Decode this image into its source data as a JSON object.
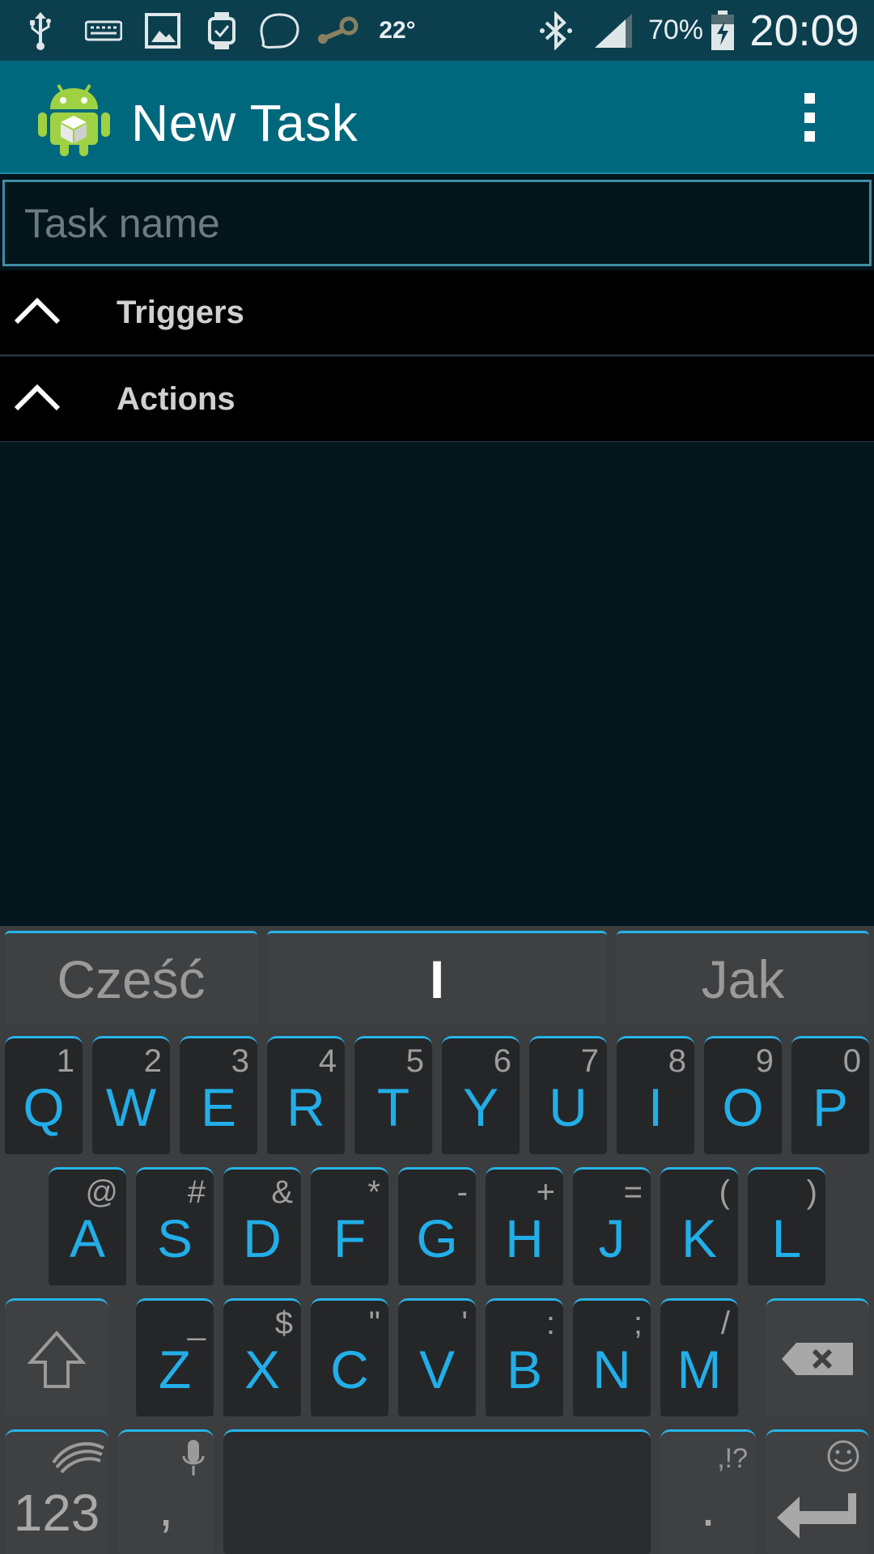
{
  "status_bar": {
    "temperature": "22°",
    "battery": "70%",
    "time": "20:09",
    "icons": [
      "usb-icon",
      "keyboard-icon",
      "image-icon",
      "smartwatch-icon",
      "speech-bubble-icon",
      "steam-icon",
      "bluetooth-icon",
      "signal-icon",
      "battery-charging-icon"
    ]
  },
  "app_bar": {
    "title": "New Task",
    "icon": "android-app-icon",
    "menu_icon": "overflow-menu-icon"
  },
  "task_name": {
    "placeholder": "Task name",
    "value": ""
  },
  "sections": [
    {
      "label": "Triggers",
      "icon": "chevron-up-icon"
    },
    {
      "label": "Actions",
      "icon": "chevron-up-icon"
    }
  ],
  "keyboard": {
    "suggestions": [
      "Cześć",
      "I",
      "Jak"
    ],
    "rows": [
      [
        {
          "main": "Q",
          "sub": "1"
        },
        {
          "main": "W",
          "sub": "2"
        },
        {
          "main": "E",
          "sub": "3"
        },
        {
          "main": "R",
          "sub": "4"
        },
        {
          "main": "T",
          "sub": "5"
        },
        {
          "main": "Y",
          "sub": "6"
        },
        {
          "main": "U",
          "sub": "7"
        },
        {
          "main": "I",
          "sub": "8"
        },
        {
          "main": "O",
          "sub": "9"
        },
        {
          "main": "P",
          "sub": "0"
        }
      ],
      [
        {
          "main": "A",
          "sub": "@"
        },
        {
          "main": "S",
          "sub": "#"
        },
        {
          "main": "D",
          "sub": "&"
        },
        {
          "main": "F",
          "sub": "*"
        },
        {
          "main": "G",
          "sub": "-"
        },
        {
          "main": "H",
          "sub": "+"
        },
        {
          "main": "J",
          "sub": "="
        },
        {
          "main": "K",
          "sub": "("
        },
        {
          "main": "L",
          "sub": ")"
        }
      ],
      [
        {
          "main": "Z",
          "sub": "_"
        },
        {
          "main": "X",
          "sub": "$"
        },
        {
          "main": "C",
          "sub": "\""
        },
        {
          "main": "V",
          "sub": "'"
        },
        {
          "main": "B",
          "sub": ":"
        },
        {
          "main": "N",
          "sub": ";"
        },
        {
          "main": "M",
          "sub": "/"
        }
      ]
    ],
    "numbers_key": "123",
    "comma_key": ",",
    "period_key": ".",
    "period_sub": ",!?",
    "accent_color": "#27b5e8",
    "key_text_color": "#22aee8"
  }
}
